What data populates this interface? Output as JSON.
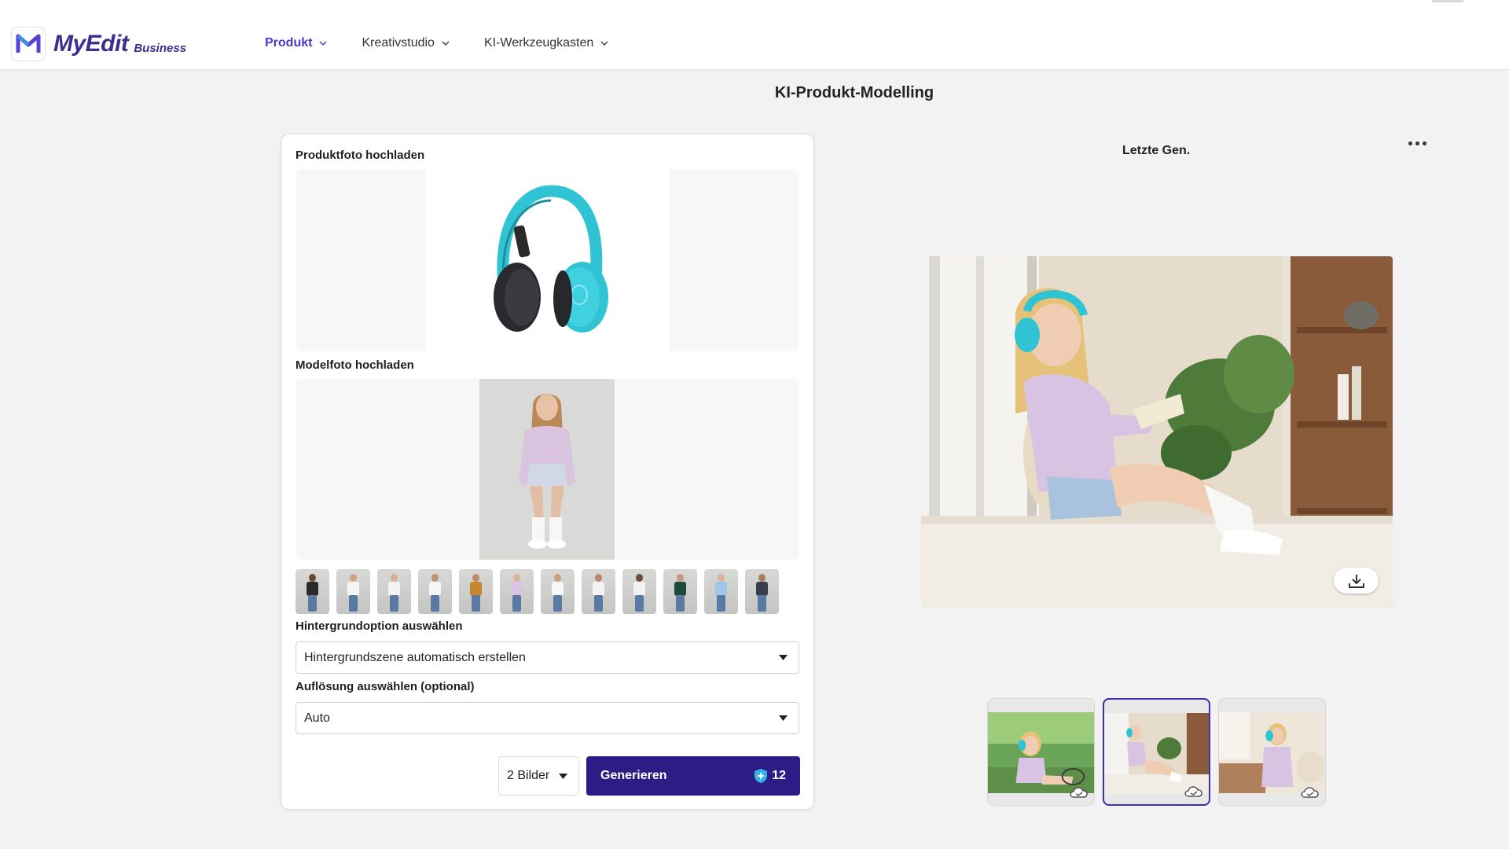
{
  "header": {
    "brand": "MyEdit",
    "brand_sub": "Business",
    "nav": [
      {
        "label": "Produkt",
        "active": true
      },
      {
        "label": "Kreativstudio",
        "active": false
      },
      {
        "label": "KI-Werkzeugkasten",
        "active": false
      }
    ]
  },
  "page": {
    "title": "KI-Produkt-Modelling"
  },
  "panel": {
    "product_label": "Produktfoto hochladen",
    "model_label": "Modelfoto hochladen",
    "background_label": "Hintergrundoption auswählen",
    "background_value": "Hintergrundszene automatisch erstellen",
    "resolution_label": "Auflösung auswählen (optional)",
    "resolution_value": "Auto",
    "count_value": "2 Bilder",
    "generate_label": "Generieren",
    "credits": "12"
  },
  "model_presets": [
    {
      "shirt": "#2a2a2a",
      "skin": "#6b4a35"
    },
    {
      "shirt": "#f5f5f5",
      "skin": "#c9a58a"
    },
    {
      "shirt": "#f3f3f3",
      "skin": "#d4b097"
    },
    {
      "shirt": "#f6f6f6",
      "skin": "#c09274"
    },
    {
      "shirt": "#c6862d",
      "skin": "#b98b6b"
    },
    {
      "shirt": "#d8c4df",
      "skin": "#d9b59c"
    },
    {
      "shirt": "#f7f7f7",
      "skin": "#caa083"
    },
    {
      "shirt": "#f4f4f4",
      "skin": "#b58768"
    },
    {
      "shirt": "#f2f2f2",
      "skin": "#6d4c38"
    },
    {
      "shirt": "#1f4a3a",
      "skin": "#c59a7e"
    },
    {
      "shirt": "#9fc6e6",
      "skin": "#d7b49b"
    },
    {
      "shirt": "#3a3f4a",
      "skin": "#a67e62"
    }
  ],
  "results": {
    "recent_label": "Letzte Gen.",
    "selected_index": 1
  },
  "colors": {
    "accent": "#4a3ac7",
    "primary_button": "#2c1c86",
    "headphone": "#2fc3d3"
  }
}
